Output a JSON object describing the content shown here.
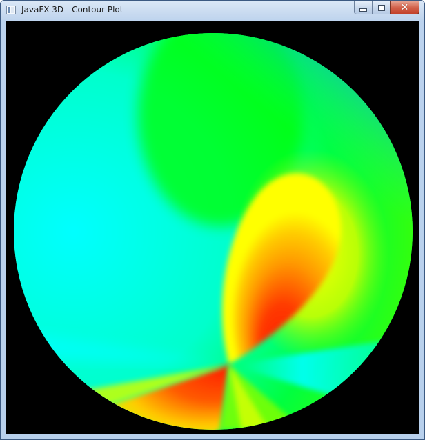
{
  "window": {
    "title": "JavaFX 3D - Contour Plot"
  },
  "icons": {
    "app": "java-window-icon",
    "minimize": "minimize-icon",
    "maximize": "maximize-icon",
    "close": "close-icon"
  },
  "plot": {
    "type": "contour color map (hue scale)",
    "background_color": "#000000",
    "colors": {
      "peak": "#ff2a00",
      "high": "#ff9a00",
      "mid_high": "#ffff00",
      "mid": "#00ff00",
      "low": "#00ffff",
      "lowest": "#0096ff"
    }
  }
}
